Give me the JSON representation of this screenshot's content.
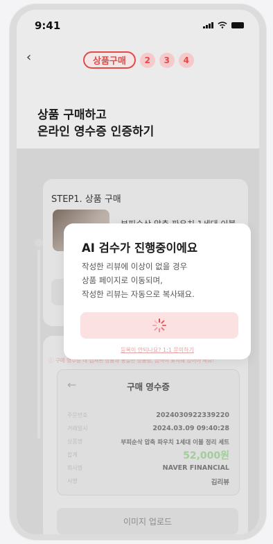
{
  "status": {
    "time": "9:41"
  },
  "nav": {
    "back_icon": "chevron-left-icon",
    "active_step_label": "상품구매",
    "steps": [
      "2",
      "3",
      "4"
    ]
  },
  "page": {
    "title_line1": "상품 구매하고",
    "title_line2": "온라인 영수증 인증하기"
  },
  "step1": {
    "title": "STEP1. 상품 구매",
    "product_name": "부피순삭 압축 파우치 1세대 이불"
  },
  "warning": "구매 영수증 내 캡쳐된 상품과 동일한 상품명, 금액이 표시돼 있어야 해요!",
  "receipt": {
    "title": "구매 영수증",
    "rows": [
      {
        "label": "주문번호",
        "value": "2024030922339220"
      },
      {
        "label": "거래일시",
        "value": "2024.03.09 09:40:28"
      },
      {
        "label": "상품명",
        "value": "부피순삭 압축 파우치 1세대 이불 정리 세트"
      },
      {
        "label": "합계",
        "value": "52,000원"
      },
      {
        "label": "회사명",
        "value": "NAVER FINANCIAL"
      },
      {
        "label": "서명",
        "value": "김리뷰"
      }
    ]
  },
  "upload_button": "이미지 업로드",
  "modal": {
    "title": "AI 검수가 진행중이에요",
    "line1": "작성한 리뷰에 이상이 없을 경우",
    "line2": "상품 페이지로 이동되며,",
    "line3": "작성한 리뷰는 자동으로 복사돼요.",
    "loader_icon": "spinner-icon",
    "link": "등록이 안되나요? 1:1 문의하기"
  },
  "colors": {
    "accent": "#e24a4a",
    "price": "#9fcf96"
  }
}
